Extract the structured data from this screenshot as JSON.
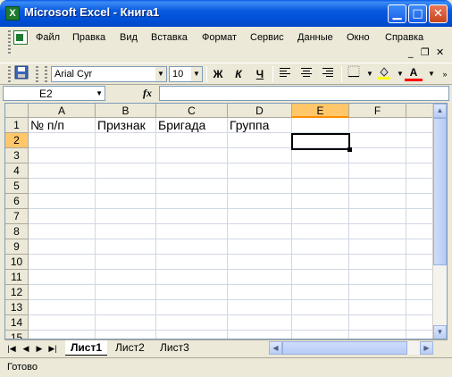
{
  "window": {
    "title": "Microsoft Excel - Книга1",
    "minimize": "▁",
    "maximize": "□",
    "close": "✕"
  },
  "menu": {
    "items": [
      "Файл",
      "Правка",
      "Вид",
      "Вставка",
      "Формат",
      "Сервис",
      "Данные",
      "Окно",
      "Справка"
    ],
    "mdi_minimize": "_",
    "mdi_restore": "❐",
    "mdi_close": "✕"
  },
  "toolbar": {
    "font_name": "Arial Cyr",
    "font_size": "10",
    "bold": "Ж",
    "italic": "К",
    "underline": "Ч",
    "font_color": "A",
    "fill_color_hex": "#ffff00",
    "font_color_hex": "#ff0000"
  },
  "formula_bar": {
    "name_box": "E2",
    "fx": "fx",
    "formula": ""
  },
  "grid": {
    "columns": [
      "A",
      "B",
      "C",
      "D",
      "E",
      "F"
    ],
    "active_column": "E",
    "rows": [
      "1",
      "2",
      "3",
      "4",
      "5",
      "6",
      "7",
      "8",
      "9",
      "10",
      "11",
      "12",
      "13",
      "14",
      "15"
    ],
    "active_row": "2",
    "cells": {
      "A1": "№ п/п",
      "B1": "Признак",
      "C1": "Бригада",
      "D1": "Группа"
    },
    "selected_cell": "E2"
  },
  "sheets": {
    "tabs": [
      "Лист1",
      "Лист2",
      "Лист3"
    ],
    "active": "Лист1"
  },
  "status": {
    "text": "Готово"
  }
}
